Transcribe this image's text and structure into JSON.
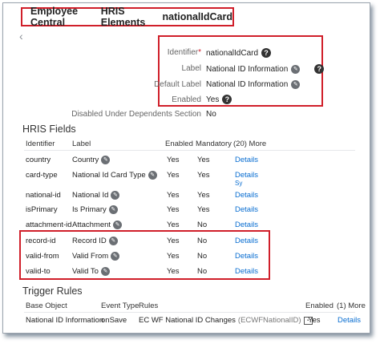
{
  "breadcrumb": [
    "Employee Central",
    "HRIS Elements",
    "nationalIdCard"
  ],
  "properties": {
    "identifier_label": "Identifier",
    "identifier_value": "nationalIdCard",
    "label_label": "Label",
    "label_value": "National ID Information",
    "default_label_label": "Default Label",
    "default_label_value": "National ID Information",
    "enabled_label": "Enabled",
    "enabled_value": "Yes",
    "disabled_dep_label": "Disabled Under Dependents Section",
    "disabled_dep_value": "No"
  },
  "hris_fields": {
    "title": "HRIS Fields",
    "headers": [
      "Identifier",
      "Label",
      "Enabled",
      "Mandatory",
      "(20) More"
    ],
    "rows": [
      {
        "id": "country",
        "label": "Country",
        "enabled": "Yes",
        "mandatory": "Yes",
        "action": "Details"
      },
      {
        "id": "card-type",
        "label": "National Id Card Type",
        "enabled": "Yes",
        "mandatory": "Yes",
        "action": "Details",
        "extra": "Sy"
      },
      {
        "id": "national-id",
        "label": "National Id",
        "enabled": "Yes",
        "mandatory": "Yes",
        "action": "Details"
      },
      {
        "id": "isPrimary",
        "label": "Is Primary",
        "enabled": "Yes",
        "mandatory": "Yes",
        "action": "Details"
      },
      {
        "id": "attachment-id",
        "label": "Attachment",
        "enabled": "Yes",
        "mandatory": "No",
        "action": "Details"
      },
      {
        "id": "record-id",
        "label": "Record ID",
        "enabled": "Yes",
        "mandatory": "No",
        "action": "Details"
      },
      {
        "id": "valid-from",
        "label": "Valid From",
        "enabled": "Yes",
        "mandatory": "No",
        "action": "Details"
      },
      {
        "id": "valid-to",
        "label": "Valid To",
        "enabled": "Yes",
        "mandatory": "No",
        "action": "Details"
      }
    ]
  },
  "trigger_rules": {
    "title": "Trigger Rules",
    "headers": [
      "Base Object",
      "Event Type",
      "Rules",
      "Enabled",
      "(1) More"
    ],
    "row": {
      "base_object": "National ID Information",
      "event_type": "onSave",
      "rule_name": "EC WF National ID Changes",
      "rule_id": "(ECWFNationalID)",
      "enabled": "Yes",
      "action": "Details"
    }
  },
  "colors": {
    "highlight_border": "#d01f2a",
    "link": "#0a6ed1"
  },
  "icons": [
    "help-icon",
    "edit-icon",
    "back-icon"
  ]
}
